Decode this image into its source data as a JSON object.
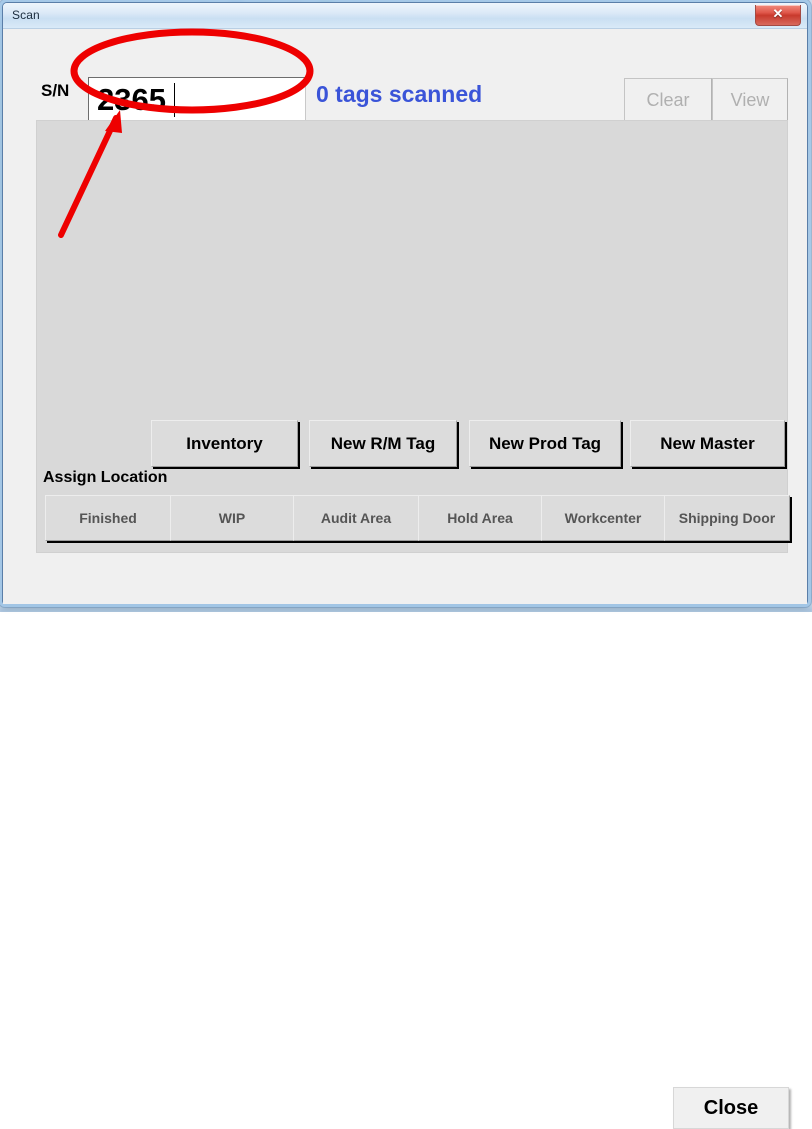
{
  "window": {
    "title": "Scan",
    "close_glyph": "✕",
    "close_tooltip": "Close"
  },
  "form": {
    "sn_label": "S/N",
    "sn_value": "2365",
    "sn_placeholder": "",
    "status_text": "0 tags scanned",
    "clear_label": "Clear",
    "view_label": "View"
  },
  "list_panel": {
    "rows": [],
    "empty_text": ""
  },
  "actions": [
    {
      "label": "Inventory"
    },
    {
      "label": "New R/M Tag"
    },
    {
      "label": "New Prod Tag"
    },
    {
      "label": "New Master"
    }
  ],
  "assign_location": {
    "heading": "Assign Location",
    "buttons": [
      {
        "label": "Finished"
      },
      {
        "label": "WIP"
      },
      {
        "label": "Audit Area"
      },
      {
        "label": "Hold Area"
      },
      {
        "label": "Workcenter"
      },
      {
        "label": "Shipping Door"
      }
    ]
  },
  "footer": {
    "close_label": "Close"
  },
  "annotations": {
    "ellipse_color": "#ee0000",
    "arrow_color": "#ee0000",
    "ellipse_target": "sn-input",
    "arrow_target": "sn-input"
  },
  "colors": {
    "status_blue": "#3a54d8",
    "panel_grey": "#d9d9d9",
    "dialog_bg": "#f0f0f0",
    "annotation_red": "#ee0000",
    "close_button_red": "#c8392c"
  }
}
